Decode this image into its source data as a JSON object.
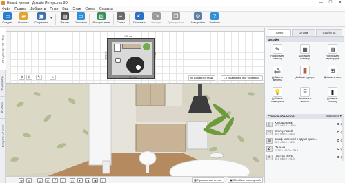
{
  "window": {
    "title": "Новый проект - Дизайн Интерьера 3D",
    "controls": {
      "minimize": "—",
      "maximize": "☐",
      "close": "✕"
    }
  },
  "menu": [
    "Файл",
    "Правка",
    "Добавить",
    "План",
    "Вид",
    "Этаж",
    "Смета",
    "Справка"
  ],
  "toolbar": [
    {
      "label": "Создать",
      "icon": "new-file-icon",
      "color": "#2b7bd0"
    },
    {
      "label": "Открыть",
      "icon": "folder-icon",
      "color": "#e0a52f"
    },
    {
      "label": "Сохранить",
      "icon": "save-icon",
      "color": "#3c6fb0"
    },
    {
      "label": "Печать",
      "icon": "printer-icon",
      "color": "#4d4d4d"
    },
    {
      "label": "Просмотр",
      "icon": "monitor-icon",
      "color": "#2f8fd8"
    },
    {
      "label": "Фотореализм",
      "icon": "photo-icon",
      "color": "#3b8e5a"
    },
    {
      "label": "Смета",
      "icon": "estimate-icon",
      "color": "#6a6a6a"
    },
    {
      "label": "Отменить",
      "icon": "undo-icon",
      "color": "#2f6fc0"
    },
    {
      "label": "Вернуть",
      "icon": "redo-icon",
      "color": "#9a9a9a"
    },
    {
      "label": "Дублировать",
      "icon": "duplicate-icon",
      "color": "#9a9a9a"
    },
    {
      "label": "Настройки",
      "icon": "gear-icon",
      "color": "#5c7ea6"
    },
    {
      "label": "Учебник",
      "icon": "help-icon",
      "color": "#2f8fd8"
    }
  ],
  "left_tabs": [
    "2D-редактор + 3D-обзор",
    "3D-редактор",
    "3D-обзор",
    "Виртуальный визит"
  ],
  "plan": {
    "buttons": {
      "add_floor": "Добавить этаж",
      "show_dims": "Показывать все размеры"
    },
    "room_dims": {
      "top": "180 см",
      "bottom": "311 см",
      "left": "280 см",
      "right": "280 см"
    }
  },
  "view3d": {
    "bottom": {
      "transparent_walls": "Прозрачные стены",
      "room_overview": "3D-обзор помещений"
    }
  },
  "right_panel": {
    "tabs": [
      "Проект",
      "Этажи",
      "Свойства"
    ],
    "active_tab": "Проект",
    "design_header": "Дизайн",
    "design_buttons": [
      {
        "label": "Нарисовать комнату",
        "icon": "draw-room-icon",
        "glyph": "✎"
      },
      {
        "label": "Добавить комнату",
        "icon": "add-room-icon",
        "glyph": "▦"
      },
      {
        "label": "Нарисовать перегородку",
        "icon": "draw-partition-icon",
        "glyph": "▤"
      },
      {
        "label": "Добавить мебель",
        "icon": "add-furniture-icon",
        "glyph": "🛋"
      },
      {
        "label": "Добавить дверь",
        "icon": "add-door-icon",
        "glyph": "🚪"
      },
      {
        "label": "Добавить окно",
        "icon": "add-window-icon",
        "glyph": "⊞"
      },
      {
        "label": "Добавить освещение",
        "icon": "add-light-icon",
        "glyph": "💡"
      },
      {
        "label": "Лестница и вырезы",
        "icon": "stairs-icon",
        "glyph": "⌸"
      },
      {
        "label": "Добавить колонну",
        "icon": "add-column-icon",
        "glyph": "▮"
      }
    ],
    "objects_header": "Список объектов",
    "objects_view": "Вид списка ▾",
    "objects": [
      {
        "name": "Холодильник",
        "dims": "60.0 x 68.0 x 189.0"
      },
      {
        "name": "Стол угловой",
        "dims": "90.0 x 90.0 x 85.0"
      },
      {
        "name": "Шкаф навесной с двумя двер...",
        "dims": "80.0 x 34.0 x 92.0"
      },
      {
        "name": "Пальма",
        "dims": "127.0 x 116.2 x 158.5"
      },
      {
        "name": "Люстра Техно",
        "dims": "60.0 x 60.0 x 51.0"
      }
    ]
  }
}
